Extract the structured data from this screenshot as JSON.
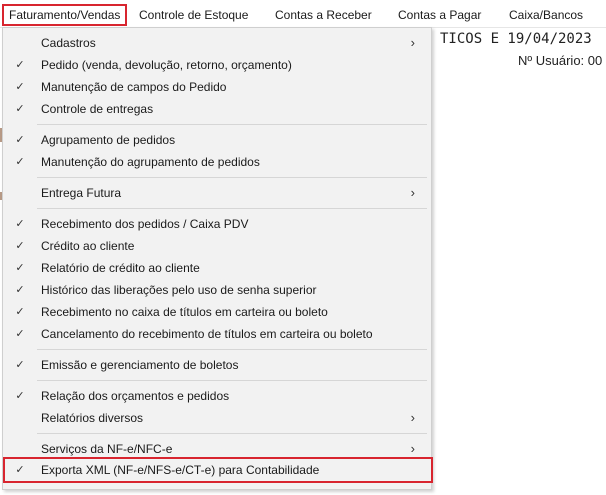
{
  "menubar": {
    "items": [
      {
        "label": "Faturamento/Vendas",
        "active": true
      },
      {
        "label": "Controle de Estoque"
      },
      {
        "label": "Contas a Receber"
      },
      {
        "label": "Contas a Pagar"
      },
      {
        "label": "Caixa/Bancos"
      }
    ]
  },
  "background": {
    "title_fragment": "TICOS E 19/04/2023",
    "user_label": "Nº Usuário: 00"
  },
  "menu": {
    "items": [
      {
        "label": "Cadastros",
        "checked": false,
        "submenu": true
      },
      {
        "label": "Pedido (venda, devolução, retorno, orçamento)",
        "checked": true
      },
      {
        "label": "Manutenção de campos do Pedido",
        "checked": true
      },
      {
        "label": "Controle de entregas",
        "checked": true
      },
      {
        "label": "Agrupamento de pedidos",
        "checked": true
      },
      {
        "label": "Manutenção do agrupamento de pedidos",
        "checked": true
      },
      {
        "label": "Entrega Futura",
        "checked": false,
        "submenu": true
      },
      {
        "label": "Recebimento dos pedidos / Caixa PDV",
        "checked": true
      },
      {
        "label": "Crédito ao cliente",
        "checked": true
      },
      {
        "label": "Relatório de crédito ao cliente",
        "checked": true
      },
      {
        "label": "Histórico das liberações pelo uso de senha superior",
        "checked": true
      },
      {
        "label": "Recebimento no caixa de títulos em carteira ou boleto",
        "checked": true
      },
      {
        "label": "Cancelamento do recebimento de títulos em carteira ou boleto",
        "checked": true
      },
      {
        "label": "Emissão e gerenciamento de boletos",
        "checked": true
      },
      {
        "label": "Relação dos orçamentos e pedidos",
        "checked": true
      },
      {
        "label": "Relatórios diversos",
        "checked": false,
        "submenu": true
      },
      {
        "label": "Serviços da NF-e/NFC-e",
        "checked": false,
        "submenu": true
      },
      {
        "label": "Exporta XML (NF-e/NFS-e/CT-e) para Contabilidade",
        "checked": true,
        "highlighted": true
      }
    ],
    "check_glyph": "✓",
    "submenu_glyph": "›"
  },
  "colors": {
    "highlight_border": "#d8252f",
    "menu_background": "#f2f2f2",
    "separator": "#d6d6d6"
  }
}
